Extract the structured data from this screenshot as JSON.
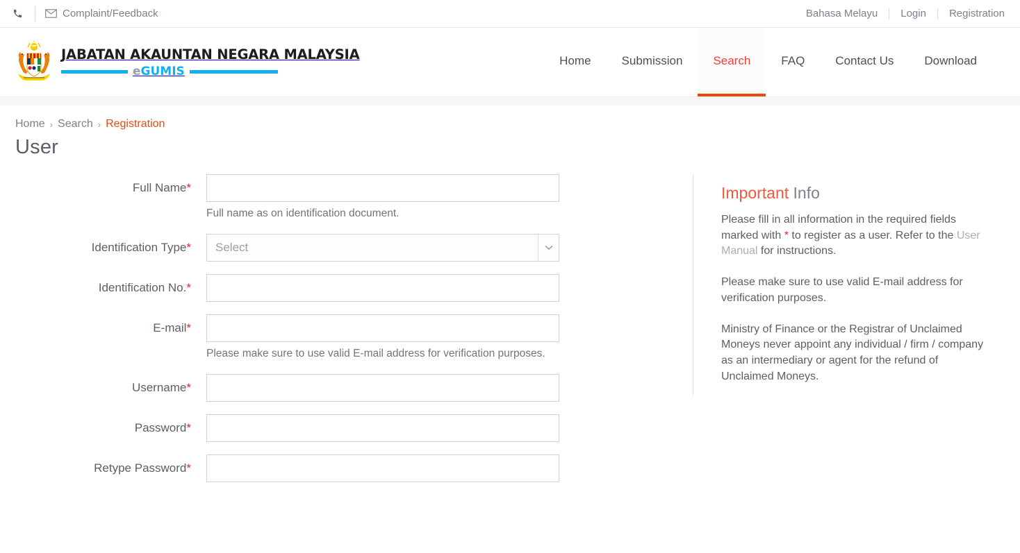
{
  "topbar": {
    "phone_icon": "phone-icon",
    "complaint_icon": "envelope-icon",
    "complaint_label": "Complaint/Feedback",
    "language_label": "Bahasa Melayu",
    "login_label": "Login",
    "registration_label": "Registration"
  },
  "header": {
    "logo": {
      "crest_icon": "malaysia-coat-of-arms",
      "title": "JABATAN AKAUNTAN NEGARA MALAYSIA",
      "brand_prefix": "e",
      "brand_name": "GUMIS",
      "bar_color": "#12b0ec"
    },
    "nav": [
      {
        "label": "Home",
        "active": false
      },
      {
        "label": "Submission",
        "active": false
      },
      {
        "label": "Search",
        "active": true
      },
      {
        "label": "FAQ",
        "active": false
      },
      {
        "label": "Contact Us",
        "active": false
      },
      {
        "label": "Download",
        "active": false
      }
    ],
    "active_color": "#ef3f34",
    "active_underline": "#e8490d"
  },
  "breadcrumb": {
    "home": "Home",
    "sep1": "›",
    "search": "Search",
    "sep2": "›",
    "current": "Registration"
  },
  "page": {
    "title": "User"
  },
  "form": {
    "full_name": {
      "label": "Full Name",
      "required": "*",
      "value": "",
      "placeholder": "",
      "help": "Full name as on identification document."
    },
    "identification_type": {
      "label": "Identification Type",
      "required": "*",
      "selected": "Select",
      "arrow_icon": "chevron-down-icon"
    },
    "identification_no": {
      "label": "Identification No.",
      "required": "*",
      "value": "",
      "placeholder": ""
    },
    "email": {
      "label": "E-mail",
      "required": "*",
      "value": "",
      "placeholder": "",
      "help": "Please make sure to use valid E-mail address for verification purposes."
    },
    "username": {
      "label": "Username",
      "required": "*",
      "value": "",
      "placeholder": ""
    },
    "password": {
      "label": "Password",
      "required": "*",
      "value": "",
      "placeholder": ""
    },
    "retype_password": {
      "label": "Retype Password",
      "required": "*",
      "value": "",
      "placeholder": ""
    }
  },
  "info": {
    "title_highlight": "Important",
    "title_rest": " Info",
    "p1_a": "Please fill in all information in the required fields marked with ",
    "p1_star": "*",
    "p1_b": " to register as a user. Refer to the ",
    "p1_link": "User Manual",
    "p1_c": " for instructions.",
    "p2": "Please make sure to use valid E-mail address for verification purposes.",
    "p3": "Ministry of Finance or the Registrar of Unclaimed Moneys never appoint any individual / firm / company as an intermediary or agent for the refund of Unclaimed Moneys."
  }
}
